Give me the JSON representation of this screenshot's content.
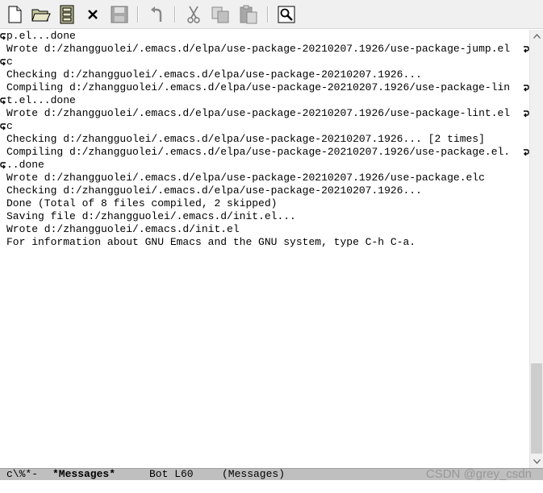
{
  "toolbar": {
    "buttons": [
      {
        "icon": "new-file-icon"
      },
      {
        "icon": "open-folder-icon"
      },
      {
        "icon": "dired-icon"
      },
      {
        "icon": "close-buffer-icon"
      },
      {
        "icon": "save-icon"
      },
      {
        "icon": "undo-icon"
      },
      {
        "icon": "cut-icon"
      },
      {
        "icon": "copy-icon"
      },
      {
        "icon": "paste-icon"
      },
      {
        "icon": "search-icon"
      }
    ]
  },
  "buffer": {
    "lines": [
      {
        "text": "p.el...done",
        "cont_left": true,
        "cont_right": false
      },
      {
        "text": "Wrote d:/zhangguolei/.emacs.d/elpa/use-package-20210207.1926/use-package-jump.el",
        "cont_left": false,
        "cont_right": true
      },
      {
        "text": "c",
        "cont_left": true,
        "cont_right": false
      },
      {
        "text": "Checking d:/zhangguolei/.emacs.d/elpa/use-package-20210207.1926...",
        "cont_left": false,
        "cont_right": false
      },
      {
        "text": "Compiling d:/zhangguolei/.emacs.d/elpa/use-package-20210207.1926/use-package-lin",
        "cont_left": false,
        "cont_right": true
      },
      {
        "text": "t.el...done",
        "cont_left": true,
        "cont_right": false
      },
      {
        "text": "Wrote d:/zhangguolei/.emacs.d/elpa/use-package-20210207.1926/use-package-lint.el",
        "cont_left": false,
        "cont_right": true
      },
      {
        "text": "c",
        "cont_left": true,
        "cont_right": false
      },
      {
        "text": "Checking d:/zhangguolei/.emacs.d/elpa/use-package-20210207.1926... [2 times]",
        "cont_left": false,
        "cont_right": false
      },
      {
        "text": "Compiling d:/zhangguolei/.emacs.d/elpa/use-package-20210207.1926/use-package.el.",
        "cont_left": false,
        "cont_right": true
      },
      {
        "text": "..done",
        "cont_left": true,
        "cont_right": false
      },
      {
        "text": "Wrote d:/zhangguolei/.emacs.d/elpa/use-package-20210207.1926/use-package.elc",
        "cont_left": false,
        "cont_right": false
      },
      {
        "text": "Checking d:/zhangguolei/.emacs.d/elpa/use-package-20210207.1926...",
        "cont_left": false,
        "cont_right": false
      },
      {
        "text": "Done (Total of 8 files compiled, 2 skipped)",
        "cont_left": false,
        "cont_right": false
      },
      {
        "text": "Saving file d:/zhangguolei/.emacs.d/init.el...",
        "cont_left": false,
        "cont_right": false
      },
      {
        "text": "Wrote d:/zhangguolei/.emacs.d/init.el",
        "cont_left": false,
        "cont_right": false
      },
      {
        "text": "For information about GNU Emacs and the GNU system, type C-h C-a.",
        "cont_left": false,
        "cont_right": false
      }
    ]
  },
  "scrollbar": {
    "position_fraction": 0.81
  },
  "modeline": {
    "status": "c\\%*-",
    "buffer_name": "*Messages*",
    "position": "Bot L60",
    "mode": "(Messages)"
  },
  "minibuffer": {
    "text": ""
  },
  "watermark": {
    "text": "CSDN @grey_csdn"
  },
  "colors": {
    "toolbar_bg": "#f0f0f0",
    "modeline_bg": "#bfbfbf",
    "text": "#000000"
  }
}
